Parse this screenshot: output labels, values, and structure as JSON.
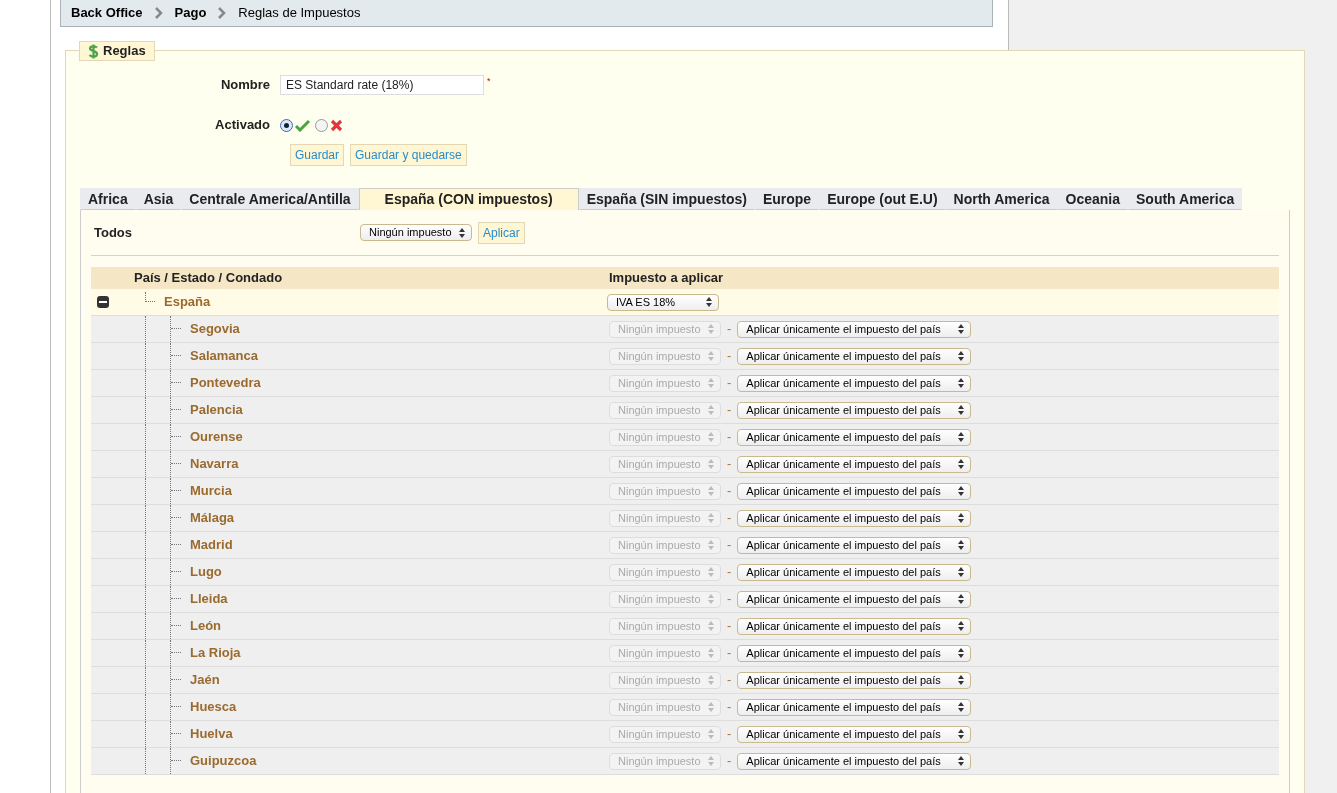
{
  "breadcrumb": [
    {
      "label": "Back Office",
      "kind": "link"
    },
    {
      "label": "Pago",
      "kind": "link"
    },
    {
      "label": "Reglas de Impuestos",
      "kind": "current"
    }
  ],
  "section": {
    "legend": "Reglas"
  },
  "form": {
    "name_label": "Nombre",
    "name_value": "ES Standard rate (18%)",
    "required_mark": "*",
    "active_label": "Activado",
    "active_options": [
      {
        "kind": "yes",
        "selected": true
      },
      {
        "kind": "no",
        "selected": false
      }
    ],
    "buttons": [
      "Guardar",
      "Guardar y quedarse"
    ]
  },
  "tabs": [
    {
      "label": "Africa",
      "selected": false
    },
    {
      "label": "Asia",
      "selected": false
    },
    {
      "label": "Centrale America/Antilla",
      "selected": false
    },
    {
      "label": "España (CON impuestos)",
      "selected": true
    },
    {
      "label": "España (SIN impuestos)",
      "selected": false
    },
    {
      "label": "Europe",
      "selected": false
    },
    {
      "label": "Europe (out E.U)",
      "selected": false
    },
    {
      "label": "North America",
      "selected": false
    },
    {
      "label": "Oceania",
      "selected": false
    },
    {
      "label": "South America",
      "selected": false
    }
  ],
  "bulk": {
    "label": "Todos",
    "tax": "Ningún impuesto",
    "button": "Aplicar"
  },
  "table": {
    "columns": [
      "País / Estado / Condado",
      "Impuesto a aplicar"
    ],
    "rows": [
      {
        "name": "España",
        "tax": "IVA ES 18%",
        "expanded": true,
        "children": [
          {
            "name": "Segovia",
            "tax": "Ningún impuesto",
            "disabled": true,
            "separator": "-",
            "behavior": "Aplicar únicamente el impuesto del país"
          },
          {
            "name": "Salamanca",
            "tax": "Ningún impuesto",
            "disabled": true,
            "separator": "-",
            "behavior": "Aplicar únicamente el impuesto del país"
          },
          {
            "name": "Pontevedra",
            "tax": "Ningún impuesto",
            "disabled": true,
            "separator": "-",
            "behavior": "Aplicar únicamente el impuesto del país"
          },
          {
            "name": "Palencia",
            "tax": "Ningún impuesto",
            "disabled": true,
            "separator": "-",
            "behavior": "Aplicar únicamente el impuesto del país"
          },
          {
            "name": "Ourense",
            "tax": "Ningún impuesto",
            "disabled": true,
            "separator": "-",
            "behavior": "Aplicar únicamente el impuesto del país"
          },
          {
            "name": "Navarra",
            "tax": "Ningún impuesto",
            "disabled": true,
            "separator": "-",
            "behavior": "Aplicar únicamente el impuesto del país"
          },
          {
            "name": "Murcia",
            "tax": "Ningún impuesto",
            "disabled": true,
            "separator": "-",
            "behavior": "Aplicar únicamente el impuesto del país"
          },
          {
            "name": "Málaga",
            "tax": "Ningún impuesto",
            "disabled": true,
            "separator": "-",
            "behavior": "Aplicar únicamente el impuesto del país"
          },
          {
            "name": "Madrid",
            "tax": "Ningún impuesto",
            "disabled": true,
            "separator": "-",
            "behavior": "Aplicar únicamente el impuesto del país"
          },
          {
            "name": "Lugo",
            "tax": "Ningún impuesto",
            "disabled": true,
            "separator": "-",
            "behavior": "Aplicar únicamente el impuesto del país"
          },
          {
            "name": "Lleida",
            "tax": "Ningún impuesto",
            "disabled": true,
            "separator": "-",
            "behavior": "Aplicar únicamente el impuesto del país"
          },
          {
            "name": "León",
            "tax": "Ningún impuesto",
            "disabled": true,
            "separator": "-",
            "behavior": "Aplicar únicamente el impuesto del país"
          },
          {
            "name": "La Rioja",
            "tax": "Ningún impuesto",
            "disabled": true,
            "separator": "-",
            "behavior": "Aplicar únicamente el impuesto del país"
          },
          {
            "name": "Jaén",
            "tax": "Ningún impuesto",
            "disabled": true,
            "separator": "-",
            "behavior": "Aplicar únicamente el impuesto del país"
          },
          {
            "name": "Huesca",
            "tax": "Ningún impuesto",
            "disabled": true,
            "separator": "-",
            "behavior": "Aplicar únicamente el impuesto del país"
          },
          {
            "name": "Huelva",
            "tax": "Ningún impuesto",
            "disabled": true,
            "separator": "-",
            "behavior": "Aplicar únicamente el impuesto del país"
          },
          {
            "name": "Guipuzcoa",
            "tax": "Ningún impuesto",
            "disabled": true,
            "separator": "-",
            "behavior": "Aplicar únicamente el impuesto del país"
          }
        ]
      }
    ]
  }
}
